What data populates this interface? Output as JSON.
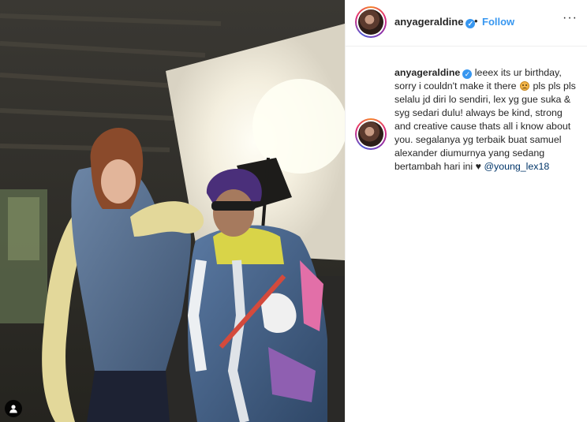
{
  "post": {
    "username": "anyageraldine",
    "separator": "•",
    "follow_label": "Follow",
    "more_label": "···"
  },
  "caption": {
    "username": "anyageraldine",
    "text_part1": "leeex its ur birthday, sorry i couldn't make it there",
    "emoji": "frowning-face-emoji",
    "text_part2": "pls pls pls selalu jd diri lo sendiri, lex yg gue suka & syg sedari dulu! always be kind, strong and creative cause thats all i know about you. segalanya yg terbaik buat samuel alexander diumurnya yang sedang bertambah hari ini ♥",
    "mention": "@young_lex18"
  },
  "icons": {
    "verified": "verified-badge-icon",
    "user_tag": "user-tag-icon",
    "more": "more-options-icon"
  },
  "colors": {
    "link": "#3897f0",
    "mention": "#003569",
    "text": "#262626",
    "border": "#efefef"
  }
}
